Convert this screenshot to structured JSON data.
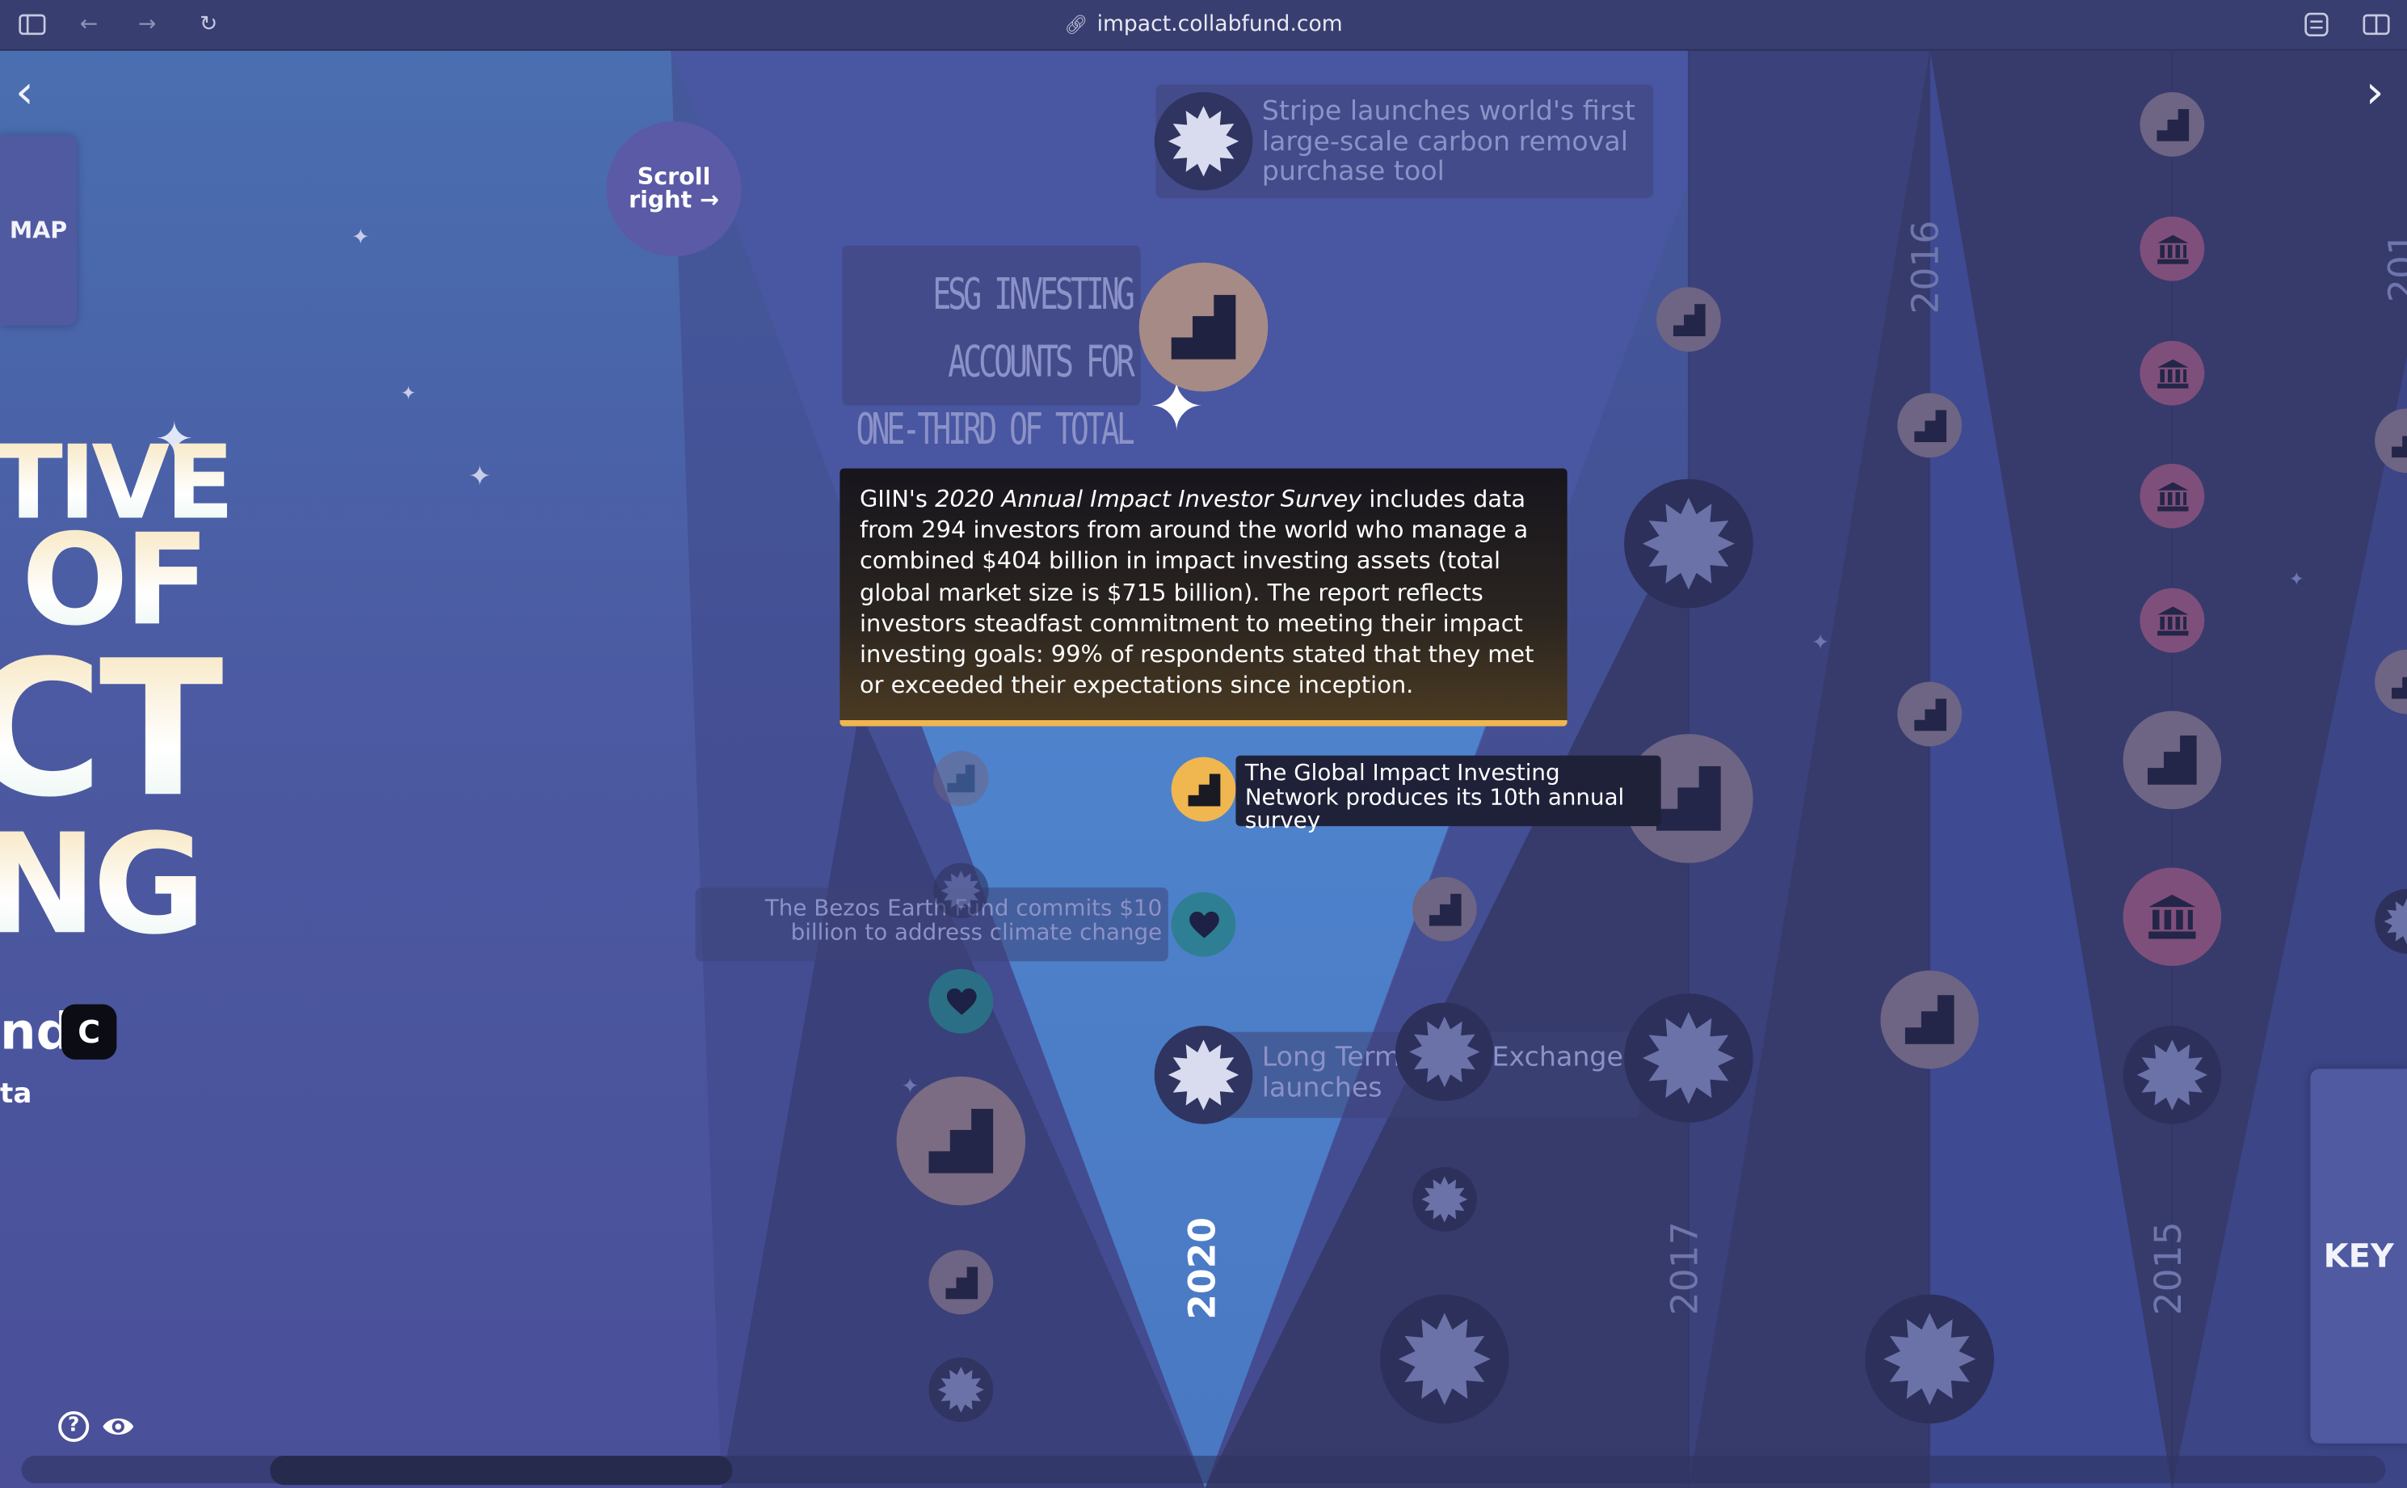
{
  "browser": {
    "url": "impact.collabfund.com",
    "icons": [
      "sidebar-toggle-icon",
      "back-arrow-icon",
      "forward-arrow-icon",
      "reload-icon",
      "link-icon",
      "extensions-icon",
      "split-view-icon"
    ]
  },
  "nav": {
    "prev_arrow": "‹",
    "next_arrow": "›",
    "map_label": "MAP",
    "key_label": "KEY",
    "scroll_hint_line1": "Scroll",
    "scroll_hint_line2": "right →"
  },
  "hero": {
    "line1": "TIVE",
    "line2": "OF",
    "line3": "CT",
    "line4": "NG",
    "brand_text": "nd",
    "brand_logo": "C",
    "brand_sub": "ta"
  },
  "timeline": {
    "years": [
      "2020",
      "2017",
      "2016",
      "2015",
      "201"
    ]
  },
  "events": {
    "stripe": "Stripe launches world's first large-scale carbon removal purchase tool",
    "esg_line1": "ESG INVESTING ACCOUNTS FOR",
    "esg_line2": "ONE-THIRD OF TOTAL US AUM",
    "giin_event": "The Global Impact Investing Network produces its 10th annual survey",
    "bezos": "The Bezos Earth Fund commits $10 billion to address climate change",
    "ltse": "Long Term Stock Exchange launches"
  },
  "tooltip": {
    "prefix": "GIIN's ",
    "italic": "2020 Annual Impact Investor Survey",
    "body": " includes data from 294 investors from around the world who manage a combined $404 billion in impact investing assets (total global market size is $715 billion). The report reflects investors steadfast commitment to meeting their impact investing goals: 99% of respondents stated that they met or exceeded their expectations since inception."
  },
  "node_types": {
    "sunburst": "sunburst-icon",
    "stairs": "stairs-icon",
    "bank": "bank-icon",
    "heart": "heart-icon"
  },
  "colors": {
    "accent_gold": "#f0b64f",
    "stairs_node": "#7e7598",
    "bank_node": "#7f4f7b",
    "heart_node": "#2e7f93",
    "sunburst_node": "#2f3460",
    "canvas_top": "#4a6fb1",
    "canvas_bottom": "#4a4f98"
  },
  "bottom": {
    "help": "?",
    "icons": [
      "help-icon",
      "eye-icon"
    ]
  }
}
